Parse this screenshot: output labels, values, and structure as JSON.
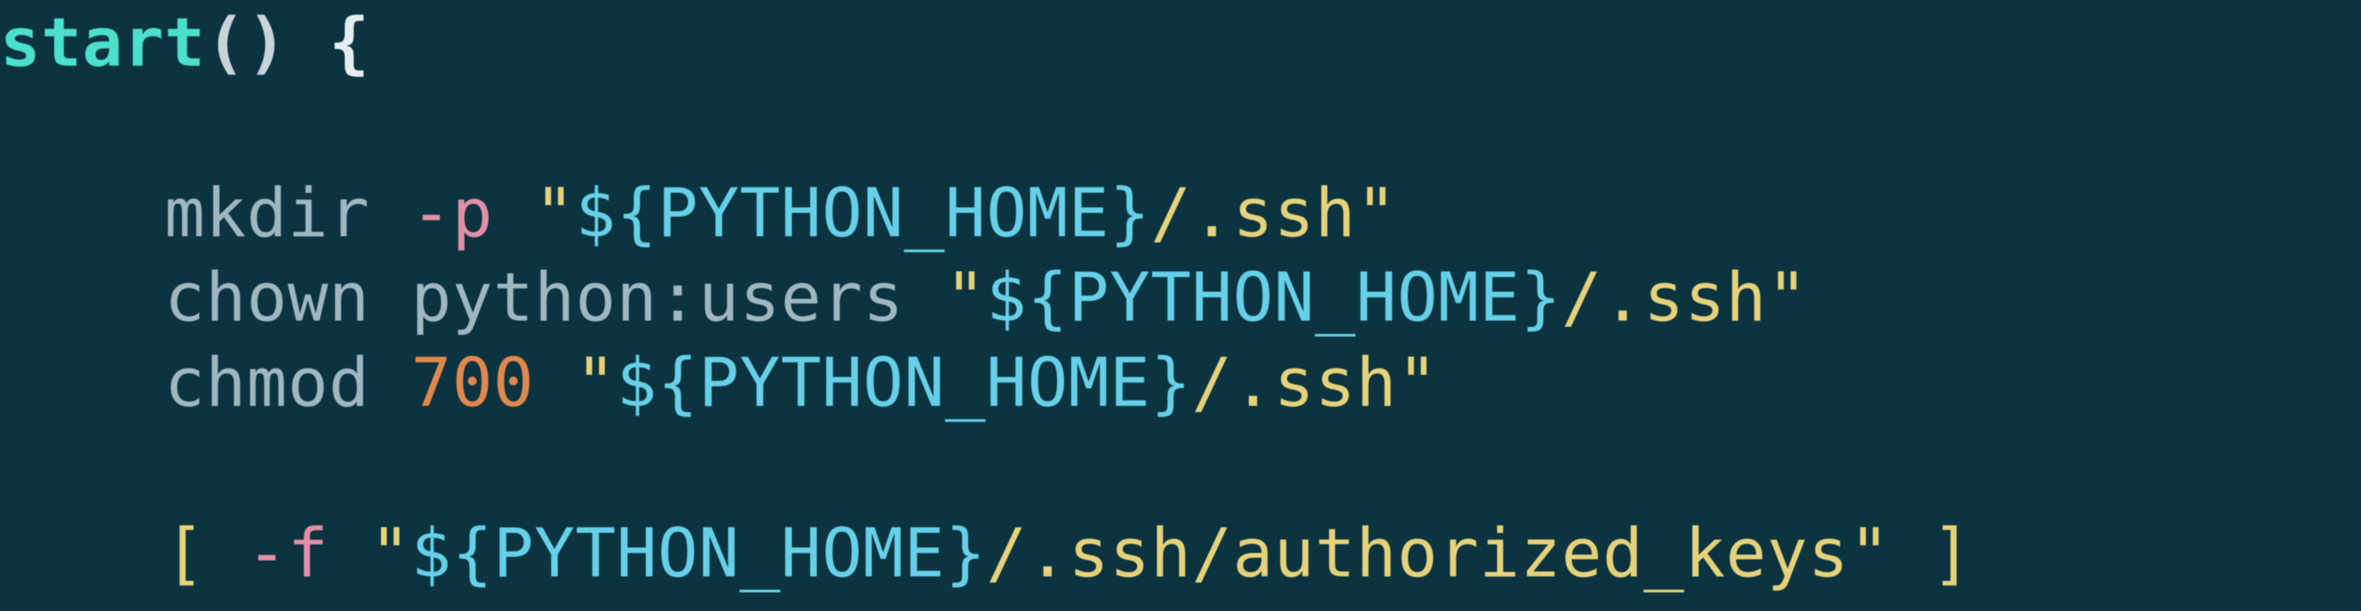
{
  "code": {
    "fn_name": "start",
    "paren": "()",
    "brace_open": "{",
    "line2": {
      "indent": "    ",
      "cmd": "mkdir ",
      "opt": "-p ",
      "q1": "\"",
      "var_open": "${",
      "var_name": "PYTHON_HOME",
      "var_close": "}",
      "path": "/.ssh",
      "q2": "\""
    },
    "line3": {
      "indent": "    ",
      "cmd": "chown ",
      "arg": "python:users ",
      "q1": "\"",
      "var_open": "${",
      "var_name": "PYTHON_HOME",
      "var_close": "}",
      "path": "/.ssh",
      "q2": "\""
    },
    "line4": {
      "indent": "    ",
      "cmd": "chmod ",
      "num": "700 ",
      "q1": "\"",
      "var_open": "${",
      "var_name": "PYTHON_HOME",
      "var_close": "}",
      "path": "/.ssh",
      "q2": "\""
    },
    "line6": {
      "indent": "    ",
      "lbrack": "[ ",
      "opt": "-f ",
      "q1": "\"",
      "var_open": "${",
      "var_name": "PYTHON_HOME",
      "var_close": "}",
      "path": "/.ssh/authorized_keys",
      "q2": "\"",
      "rbrack": " ]"
    }
  }
}
